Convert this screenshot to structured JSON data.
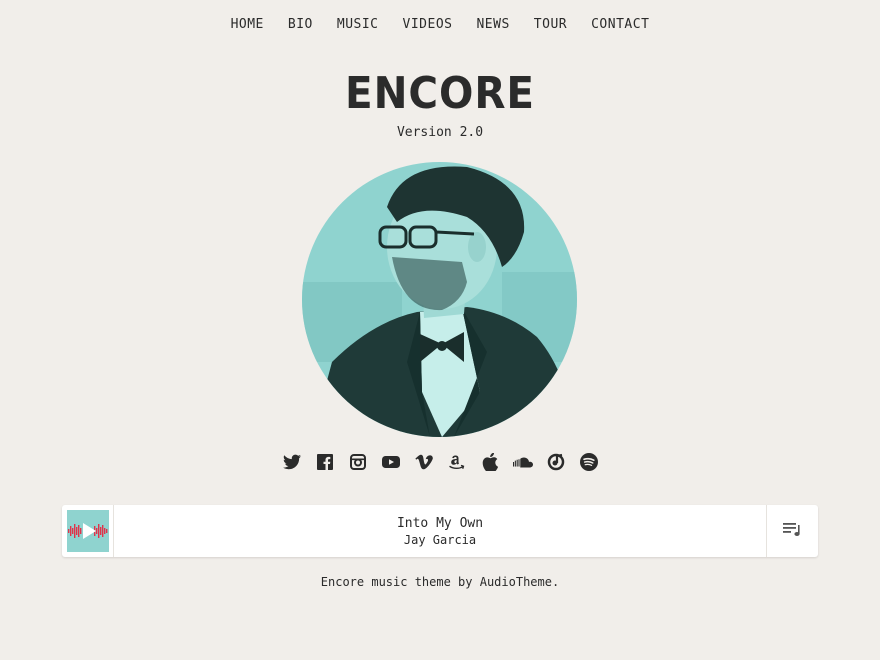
{
  "nav": {
    "items": [
      {
        "label": "HOME"
      },
      {
        "label": "BIO"
      },
      {
        "label": "MUSIC"
      },
      {
        "label": "VIDEOS"
      },
      {
        "label": "NEWS"
      },
      {
        "label": "TOUR"
      },
      {
        "label": "CONTACT"
      }
    ]
  },
  "site": {
    "title": "ENCORE",
    "tagline": "Version 2.0"
  },
  "social": {
    "icons": [
      "twitter-icon",
      "facebook-icon",
      "instagram-icon",
      "youtube-icon",
      "vimeo-icon",
      "amazon-icon",
      "apple-icon",
      "soundcloud-icon",
      "itunes-icon",
      "spotify-icon"
    ]
  },
  "player": {
    "track_title": "Into My Own",
    "artist": "Jay Garcia"
  },
  "footer": {
    "credit": "Encore music theme by AudioTheme."
  },
  "colors": {
    "background": "#f1eeea",
    "accent": "#8fd3cf",
    "waveform": "#e0334a",
    "text": "#2b2b2b"
  }
}
